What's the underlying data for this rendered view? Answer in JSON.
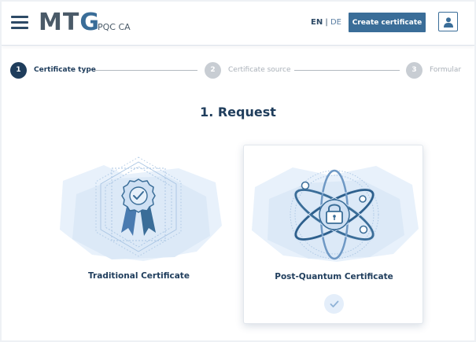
{
  "header": {
    "logo_main": "MT",
    "logo_accent": "G",
    "subtitle": "PQC CA",
    "lang_en": "EN",
    "lang_sep": " | ",
    "lang_de": "DE",
    "create_button": "Create certificate"
  },
  "stepper": {
    "steps": [
      {
        "number": "1",
        "label": "Certificate type",
        "state": "active"
      },
      {
        "number": "2",
        "label": "Certificate source",
        "state": "inactive"
      },
      {
        "number": "3",
        "label": "Formular",
        "state": "inactive"
      }
    ]
  },
  "main": {
    "title": "1. Request",
    "options": [
      {
        "label": "Traditional Certificate",
        "icon": "award-ribbon-icon",
        "selected": false
      },
      {
        "label": "Post-Quantum Certificate",
        "icon": "atom-lock-icon",
        "selected": true
      }
    ]
  },
  "colors": {
    "primary": "#3a6d98",
    "dark": "#1f3d5c",
    "inactive": "#c8cdd3"
  }
}
